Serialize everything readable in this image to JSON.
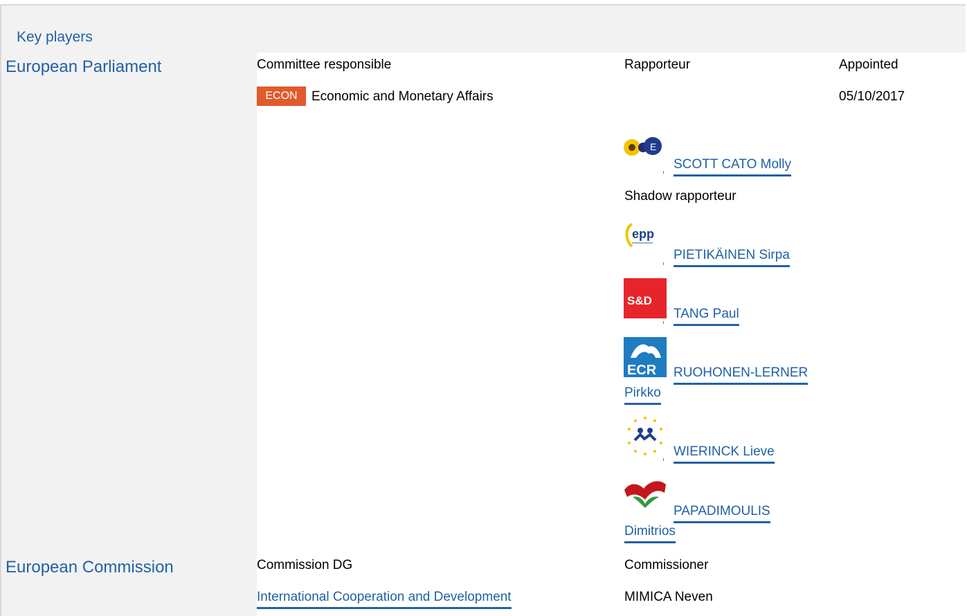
{
  "section_title": "Key players",
  "parliament": {
    "institution": "European Parliament",
    "col_committee": "Committee responsible",
    "col_rapporteur": "Rapporteur",
    "col_appointed": "Appointed",
    "committee_badge": "ECON",
    "committee_name": "Economic and Monetary Affairs",
    "appointed_date": "05/10/2017",
    "rapporteur": {
      "name": "SCOTT CATO Molly",
      "group_icon": "greens-efa-logo-icon"
    },
    "shadow_label": "Shadow rapporteur",
    "shadows": [
      {
        "name": "PIETIKÄINEN Sirpa",
        "group_icon": "epp-logo-icon",
        "group_text": "epp"
      },
      {
        "name": "TANG Paul",
        "group_icon": "sd-logo-icon",
        "group_text": "S&D"
      },
      {
        "name_line1": "RUOHONEN-LERNER",
        "name_line2": "Pirkko",
        "group_icon": "ecr-logo-icon",
        "group_text": "ECR"
      },
      {
        "name": "WIERINCK Lieve",
        "group_icon": "alde-logo-icon"
      },
      {
        "name_line1": "PAPADIMOULIS",
        "name_line2": "Dimitrios",
        "group_icon": "gue-ngl-logo-icon"
      }
    ]
  },
  "commission": {
    "institution": "European Commission",
    "col_dg": "Commission DG",
    "col_commissioner": "Commissioner",
    "dg_name": "International Cooperation and Development",
    "commissioner_name": "MIMICA Neven"
  },
  "colors": {
    "accent": "#2161a5",
    "badge": "#e05a2b",
    "panel": "#f2f2f2"
  }
}
